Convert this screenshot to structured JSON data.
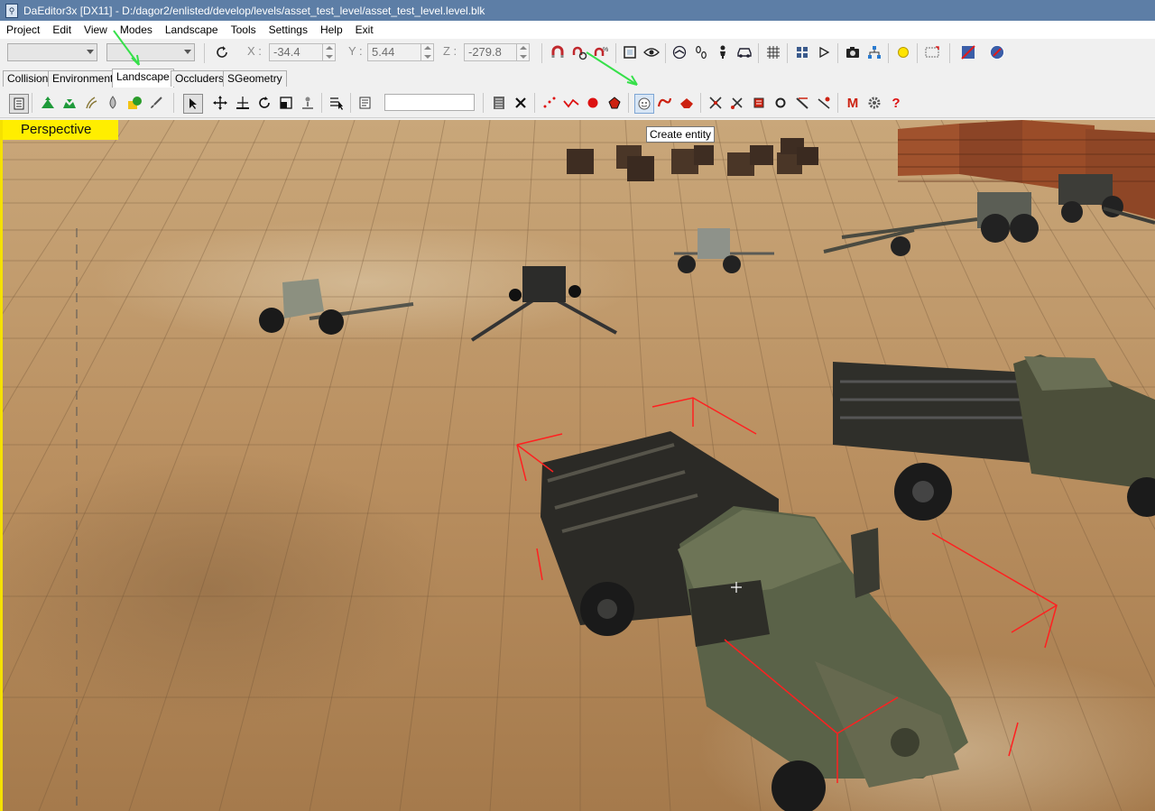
{
  "window": {
    "title": "DaEditor3x  [DX11]  - D:/dagor2/enlisted/develop/levels/asset_test_level/asset_test_level.level.blk",
    "app_icon": "editor-app-icon"
  },
  "menu": [
    "Project",
    "Edit",
    "View",
    "Modes",
    "Landscape",
    "Tools",
    "Settings",
    "Help",
    "Exit"
  ],
  "toolbar": {
    "combo1_value": "",
    "combo2_value": "",
    "x_label": "X :",
    "x_value": "-34.4",
    "y_label": "Y :",
    "y_value": "5.44",
    "z_label": "Z :",
    "z_value": "-279.8",
    "icons": [
      "refresh-icon",
      "magnet-icon",
      "magnet-wheel-icon",
      "magnet-settings-icon",
      "zoom-extents-icon",
      "eye-icon",
      "navigation-icon",
      "footprints-icon",
      "character-icon",
      "car-icon",
      "grid-icon",
      "tiles-icon",
      "play-icon",
      "camera-icon",
      "network-icon",
      "sun-icon",
      "frame-icon",
      "no-render-icon",
      "compass-icon"
    ]
  },
  "tabs": [
    {
      "label": "Collision",
      "active": false
    },
    {
      "label": "Environment",
      "active": false
    },
    {
      "label": "Landscape",
      "active": true
    },
    {
      "label": "Occluders",
      "active": false
    },
    {
      "label": "SGeometry",
      "active": false
    }
  ],
  "toolbar2": {
    "search_value": "",
    "icons": [
      "layers-icon",
      "terrain-up-icon",
      "terrain-down-icon",
      "grass-icon",
      "water-drop-icon",
      "tree-icon",
      "brush-icon",
      "select-arrow-icon",
      "move-icon",
      "move-surface-icon",
      "rotate-icon",
      "scale-icon",
      "drop-to-ground-icon",
      "select-by-name-icon",
      "properties-icon",
      "list-icon",
      "delete-icon",
      "spline-points-icon",
      "spline-icon",
      "point-icon",
      "polygon-icon",
      "create-entity-icon",
      "spline-create-icon",
      "polygon-create-icon",
      "crossroad-icon",
      "cut-icon",
      "bookmark-icon",
      "circle-icon",
      "ruler-icon",
      "split-icon",
      "m-icon",
      "gear-icon",
      "help-icon"
    ]
  },
  "tooltip": "Create entity",
  "viewport": {
    "label": "Perspective",
    "accent_color": "#ffee00",
    "selection_color": "#ff2020",
    "arrow_color": "#36e04a"
  }
}
